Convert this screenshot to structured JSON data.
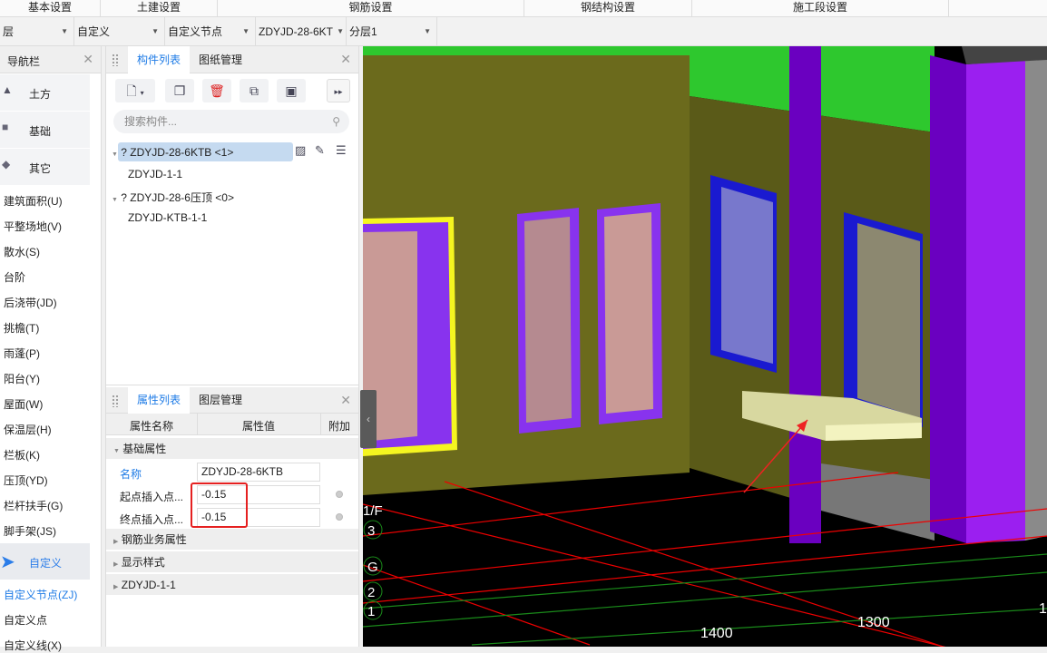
{
  "menu": [
    "基本设置",
    "土建设置",
    "钢筋设置",
    "钢结构设置",
    "施工段设置"
  ],
  "toolbar": {
    "floor": "层",
    "category": "自定义",
    "type": "自定义节点",
    "component": "ZDYJD-28-6KT",
    "layer": "分层1"
  },
  "nav": {
    "title": "导航栏",
    "big": [
      "土方",
      "基础",
      "其它"
    ],
    "items": [
      "建筑面积(U)",
      "平整场地(V)",
      "散水(S)",
      "台阶",
      "后浇带(JD)",
      "挑檐(T)",
      "雨蓬(P)",
      "阳台(Y)",
      "屋面(W)",
      "保温层(H)",
      "栏板(K)",
      "压顶(YD)",
      "栏杆扶手(G)",
      "脚手架(JS)"
    ],
    "selected": "自定义",
    "sub": [
      "自定义节点(ZJ)",
      "自定义点",
      "自定义线(X)"
    ]
  },
  "components": {
    "tabs": [
      "构件列表",
      "图纸管理"
    ],
    "search_placeholder": "搜索构件...",
    "tree": [
      {
        "label": "? ZDYJD-28-6KTB <1>",
        "child": "ZDYJD-1-1"
      },
      {
        "label": "? ZDYJD-28-6压顶 <0>",
        "child": "ZDYJD-KTB-1-1"
      }
    ]
  },
  "props": {
    "tabs": [
      "属性列表",
      "图层管理"
    ],
    "headers": [
      "属性名称",
      "属性值",
      "附加"
    ],
    "group": "基础属性",
    "rows": [
      {
        "name": "名称",
        "value": "ZDYJD-28-6KTB"
      },
      {
        "name": "起点插入点...",
        "value": "-0.15"
      },
      {
        "name": "终点插入点...",
        "value": "-0.15"
      }
    ],
    "groups": [
      "钢筋业务属性",
      "显示样式",
      "ZDYJD-1-1"
    ]
  },
  "viewport": {
    "axis_labels": [
      "1/F",
      "3",
      "G",
      "2",
      "1"
    ],
    "dims": [
      "1400",
      "1300",
      "1"
    ]
  }
}
